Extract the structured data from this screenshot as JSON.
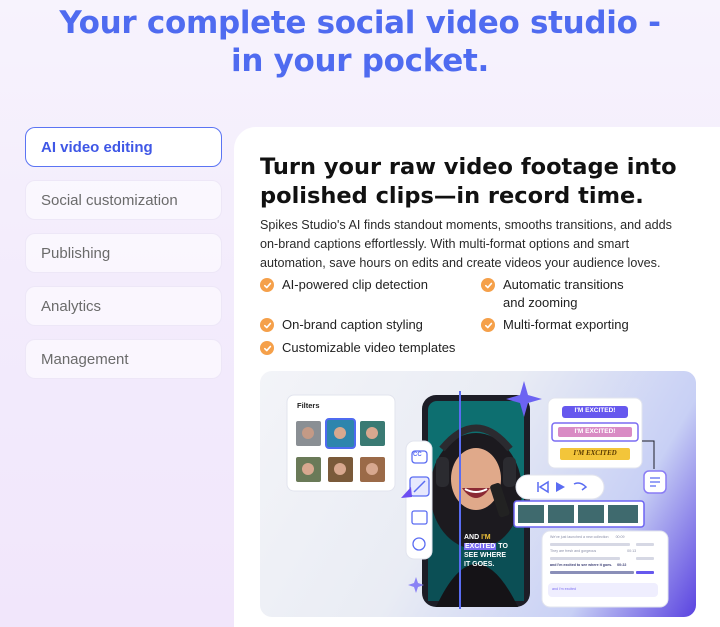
{
  "hero": {
    "title_line1": "Your complete social video studio -",
    "title_line2": "in your pocket."
  },
  "tabs": [
    {
      "label": "AI video editing",
      "active": true
    },
    {
      "label": "Social customization",
      "active": false
    },
    {
      "label": "Publishing",
      "active": false
    },
    {
      "label": "Analytics",
      "active": false
    },
    {
      "label": "Management",
      "active": false
    }
  ],
  "content": {
    "title_line1": "Turn your raw video footage into",
    "title_line2": "polished clips—in record time.",
    "description": "Spikes Studio's AI finds standout moments, smooths transitions, and adds on-brand captions effortlessly. With multi-format options and smart automation, save hours on edits and create videos your audience loves.",
    "features": [
      "AI-powered clip detection",
      "Automatic transitions",
      "and zooming",
      "On-brand caption styling",
      "Multi-format exporting",
      "Customizable video templates"
    ]
  },
  "mockup": {
    "filters_label": "Filters",
    "caption_style_1": "I'M EXCITED!",
    "caption_style_2": "I'M EXCITED!",
    "caption_style_3": "I'M EXCITED",
    "cc_label": "CC",
    "video_caption_line1": "AND",
    "video_caption_highlight": "I'M",
    "video_caption_line2_highlight": "EXCITED",
    "video_caption_line2": "TO",
    "video_caption_line3": "SEE WHERE",
    "video_caption_line4": "IT GOES.",
    "transcript": [
      {
        "text": "We've just launched a new collection",
        "time": "00:09"
      },
      {
        "text": "They are fresh and gorgeous",
        "time": "00:13"
      },
      {
        "text": "and I'm excited to see where it goes.",
        "time": "00:22"
      },
      {
        "text": "and I'm excited",
        "time": ""
      }
    ],
    "colors": {
      "accent": "#4f6bf0",
      "check": "#f5a04a",
      "purple": "#5a43e0",
      "caption_yellow": "#f3c53a"
    }
  }
}
